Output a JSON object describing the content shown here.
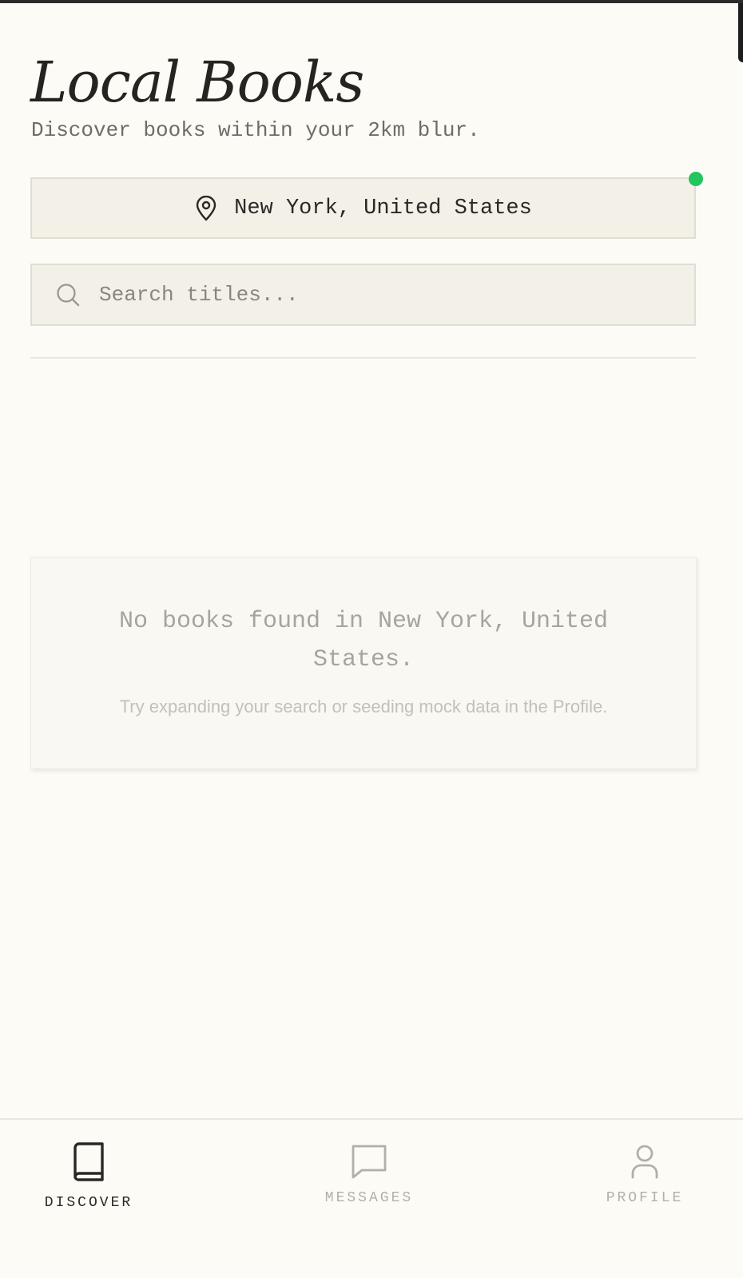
{
  "header": {
    "title": "Local Books",
    "subtitle": "Discover books within your 2km blur."
  },
  "location": {
    "label": "New York, United States",
    "icon": "map-pin-icon",
    "status_color": "#22c55e"
  },
  "search": {
    "placeholder": "Search titles...",
    "value": "",
    "icon": "search-icon"
  },
  "empty_state": {
    "title": "No books found in New York, United States.",
    "hint": "Try expanding your search or seeding mock data in the Profile."
  },
  "nav": {
    "items": [
      {
        "label": "DISCOVER",
        "icon": "book-icon",
        "active": true
      },
      {
        "label": "MESSAGES",
        "icon": "message-icon",
        "active": false
      },
      {
        "label": "PROFILE",
        "icon": "user-icon",
        "active": false
      }
    ]
  },
  "colors": {
    "background": "#fdfbf6",
    "input_background": "#f3f0e8",
    "accent_dark": "#2a2825",
    "inactive": "#b3afa8"
  }
}
